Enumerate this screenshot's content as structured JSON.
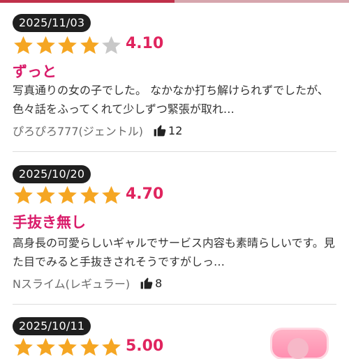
{
  "colors": {
    "star_on": "#f5a623",
    "star_off": "#c8c8c8",
    "score": "#e0245e",
    "title": "#d91b6a"
  },
  "reviews": [
    {
      "date": "2025/11/03",
      "rating": 4.1,
      "score": "4.10",
      "title": "ずっと",
      "body": "写真通りの女の子でした。 なかなか打ち解けられずでしたが、色々話をふってくれて少しずつ緊張が取れ…",
      "author": "ぴろぴろ777(ジェントル)",
      "likes": "12"
    },
    {
      "date": "2025/10/20",
      "rating": 4.7,
      "score": "4.70",
      "title": "手抜き無し",
      "body": "高身長の可愛らしいギャルでサービス内容も素晴らしいです。見た目でみると手抜きされそうですがしっ…",
      "author": "Nスライム(レギュラー)",
      "likes": "8"
    },
    {
      "date": "2025/10/11",
      "rating": 5.0,
      "score": "5.00"
    }
  ],
  "icons": {
    "like": "thumbs-up-icon",
    "star": "star-icon"
  }
}
